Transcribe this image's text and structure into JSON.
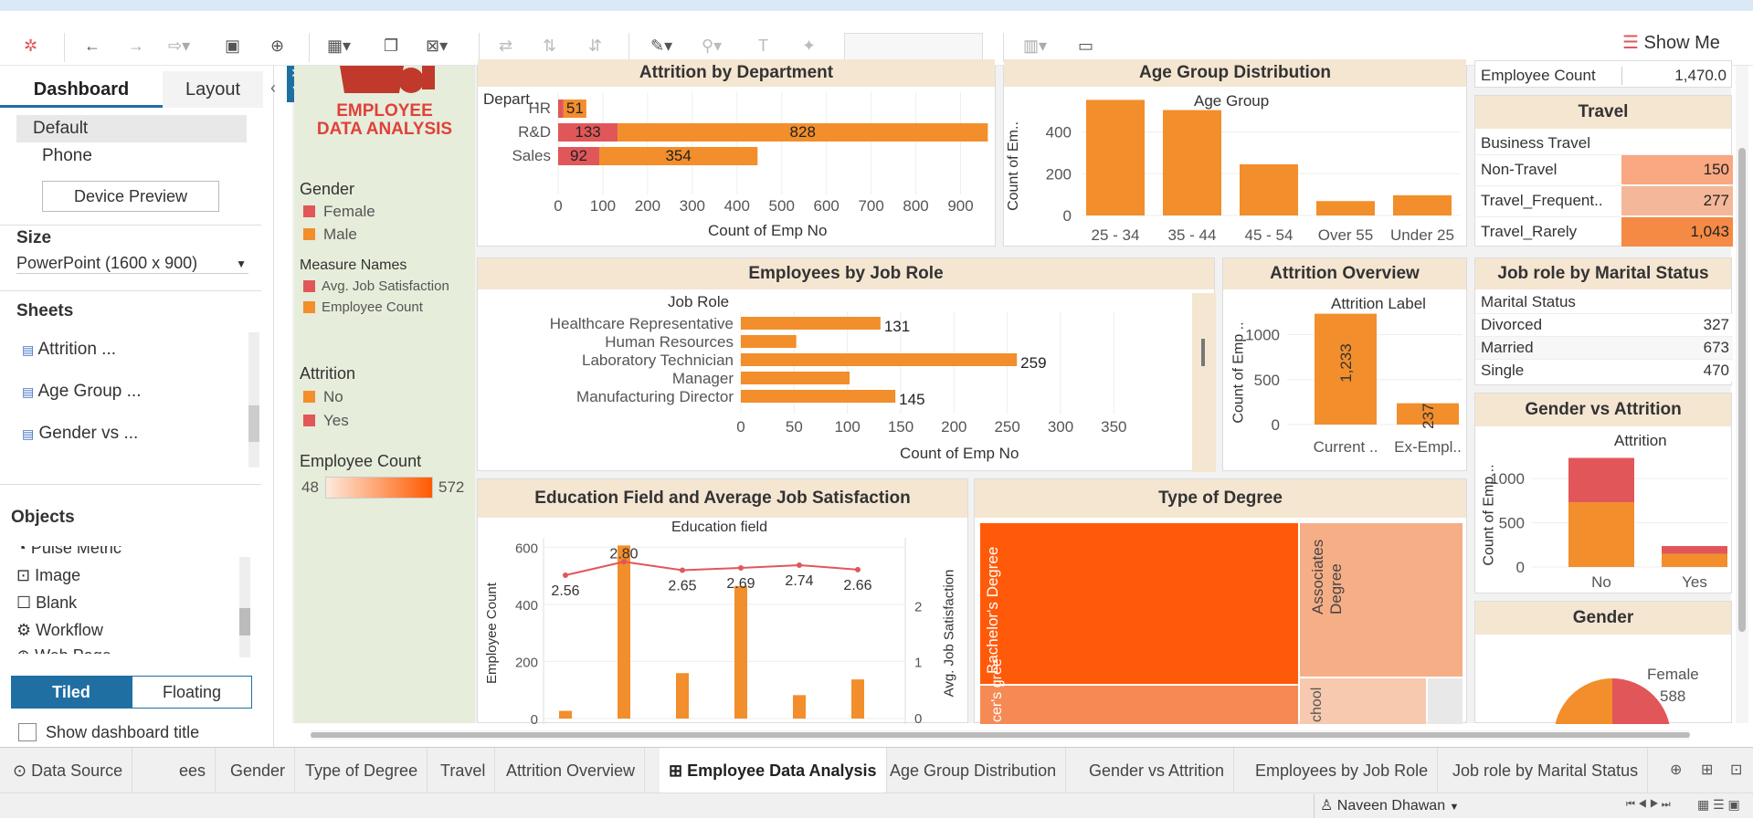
{
  "toolbar": {
    "show_me": "Show Me"
  },
  "left": {
    "tab_dashboard": "Dashboard",
    "tab_layout": "Layout",
    "device": [
      "Default",
      "Phone"
    ],
    "device_preview": "Device Preview",
    "size_title": "Size",
    "size_value": "PowerPoint (1600 x 900)",
    "sheets_title": "Sheets",
    "sheets": [
      "Attrition ...",
      "Age Group ...",
      "Gender vs ..."
    ],
    "objects_title": "Objects",
    "objects": [
      "Pulse Metric",
      "Image",
      "Blank",
      "Workflow",
      "Web Page"
    ],
    "tiled": "Tiled",
    "floating": "Floating",
    "show_title": "Show dashboard title"
  },
  "logo": {
    "line1": "EMPLOYEE",
    "line2": "DATA ANALYSIS"
  },
  "legends": {
    "gender_title": "Gender",
    "gender": [
      "Female",
      "Male"
    ],
    "measure_title": "Measure Names",
    "measures": [
      "Avg. Job Satisfaction",
      "Employee Count"
    ],
    "attrition_title": "Attrition",
    "attrition": [
      "No",
      "Yes"
    ],
    "empcount_title": "Employee Count",
    "emp_min": "48",
    "emp_max": "572"
  },
  "colors": {
    "orange": "#f28e2b",
    "red": "#e15759"
  },
  "attr_dept": {
    "title": "Attrition by Department",
    "header": "Depart..",
    "xlabel": "Count of Emp No",
    "ticks": [
      "0",
      "100",
      "200",
      "300",
      "400",
      "500",
      "600",
      "700",
      "800",
      "900"
    ],
    "rows": [
      {
        "label": "HR",
        "yes": "",
        "no": "51"
      },
      {
        "label": "R&D",
        "yes": "133",
        "no": "828"
      },
      {
        "label": "Sales",
        "yes": "92",
        "no": "354"
      }
    ]
  },
  "age": {
    "title": "Age Group Distribution",
    "header": "Age Group",
    "ylabel": "Count of Em..",
    "ticks": [
      "400",
      "200",
      "0"
    ],
    "cats": [
      "25 - 34",
      "35 - 44",
      "45 - 54",
      "Over 55",
      "Under 25"
    ]
  },
  "topright": {
    "label": "Employee Count",
    "value": "1,470.0"
  },
  "travel": {
    "title": "Travel",
    "header": "Business Travel",
    "rows": [
      {
        "label": "Non-Travel",
        "value": "150"
      },
      {
        "label": "Travel_Frequent..",
        "value": "277"
      },
      {
        "label": "Travel_Rarely",
        "value": "1,043"
      }
    ]
  },
  "jobrole": {
    "title": "Employees by Job Role",
    "header": "Job Role",
    "xlabel": "Count of Emp No",
    "ticks": [
      "0",
      "50",
      "100",
      "150",
      "200",
      "250",
      "300",
      "350"
    ],
    "rows": [
      {
        "label": "Healthcare Representative",
        "value": "131"
      },
      {
        "label": "Human Resources",
        "value": ""
      },
      {
        "label": "Laboratory Technician",
        "value": "259"
      },
      {
        "label": "Manager",
        "value": ""
      },
      {
        "label": "Manufacturing Director",
        "value": "145"
      }
    ]
  },
  "attr_overview": {
    "title": "Attrition Overview",
    "header": "Attrition Label",
    "ylabel": "Count of Emp ..",
    "ticks": [
      "1000",
      "500",
      "0"
    ],
    "cats": [
      "Current ..",
      "Ex-Empl.."
    ],
    "vals": [
      "1,233",
      "237"
    ]
  },
  "marital": {
    "title": "Job role by Marital Status",
    "header": "Marital Status",
    "rows": [
      {
        "label": "Divorced",
        "value": "327"
      },
      {
        "label": "Married",
        "value": "673"
      },
      {
        "label": "Single",
        "value": "470"
      }
    ]
  },
  "edu": {
    "title": "Education Field and  Average Job Satisfaction",
    "header": "Education field",
    "ylabel": "Employee Count",
    "y2label": "Avg. Job Satisfaction",
    "ticks": [
      "600",
      "400",
      "200",
      "0"
    ],
    "ticks2": [
      "2",
      "1",
      "0"
    ],
    "points": [
      "2.56",
      "2.80",
      "2.65",
      "2.69",
      "2.74",
      "2.66"
    ]
  },
  "degree": {
    "title": "Type of Degree",
    "labels": [
      "Bachelor's Degree",
      "Associates Degree",
      "cer's gree",
      "chool"
    ]
  },
  "gva": {
    "title": "Gender vs Attrition",
    "header": "Attrition",
    "ylabel": "Count of Emp ..",
    "ticks": [
      "1000",
      "500",
      "0"
    ],
    "cats": [
      "No",
      "Yes"
    ]
  },
  "gender": {
    "title": "Gender",
    "label": "Female",
    "value": "588"
  },
  "tabs": [
    "Data Source",
    "ees",
    "Gender",
    "Type of Degree",
    "Travel",
    "Attrition Overview",
    "Employee Data Analysis",
    "Age Group Distribution",
    "Gender vs Attrition",
    "Employees by Job Role",
    "Job role by Marital Status"
  ],
  "status": {
    "user": "Naveen Dhawan"
  },
  "chart_data": [
    {
      "type": "bar",
      "title": "Attrition by Department",
      "categories": [
        "HR",
        "R&D",
        "Sales"
      ],
      "series": [
        {
          "name": "Yes",
          "values": [
            12,
            133,
            92
          ]
        },
        {
          "name": "No",
          "values": [
            51,
            828,
            354
          ]
        }
      ],
      "xlabel": "Count of Emp No",
      "xlim": [
        0,
        950
      ]
    },
    {
      "type": "bar",
      "title": "Age Group Distribution",
      "categories": [
        "25 - 34",
        "35 - 44",
        "45 - 54",
        "Over 55",
        "Under 25"
      ],
      "values": [
        554,
        505,
        245,
        69,
        97
      ],
      "ylabel": "Count of Em..",
      "ylim": [
        0,
        560
      ]
    },
    {
      "type": "bar",
      "title": "Employees by Job Role",
      "categories": [
        "Healthcare Representative",
        "Human Resources",
        "Laboratory Technician",
        "Manager",
        "Manufacturing Director"
      ],
      "values": [
        131,
        52,
        259,
        102,
        145
      ],
      "xlabel": "Count of Emp No",
      "xlim": [
        0,
        360
      ]
    },
    {
      "type": "bar",
      "title": "Attrition Overview",
      "categories": [
        "Current ..",
        "Ex-Empl.."
      ],
      "values": [
        1233,
        237
      ],
      "ylabel": "Count of Emp ..",
      "ylim": [
        0,
        1300
      ]
    },
    {
      "type": "bar",
      "title": "Education Field and  Average Job Satisfaction",
      "series": [
        {
          "name": "Employee Count",
          "values": [
            27,
            606,
            159,
            464,
            82,
            137
          ]
        },
        {
          "name": "Avg. Job Satisfaction",
          "values": [
            2.56,
            2.8,
            2.65,
            2.69,
            2.74,
            2.66
          ]
        }
      ],
      "ylabel": "Employee Count",
      "ylim": [
        0,
        620
      ]
    },
    {
      "type": "bar",
      "title": "Gender vs Attrition",
      "categories": [
        "No",
        "Yes"
      ],
      "series": [
        {
          "name": "Male",
          "values": [
            732,
            150
          ]
        },
        {
          "name": "Female",
          "values": [
            501,
            87
          ]
        }
      ],
      "ylabel": "Count of Emp ..",
      "ylim": [
        0,
        1300
      ]
    }
  ]
}
